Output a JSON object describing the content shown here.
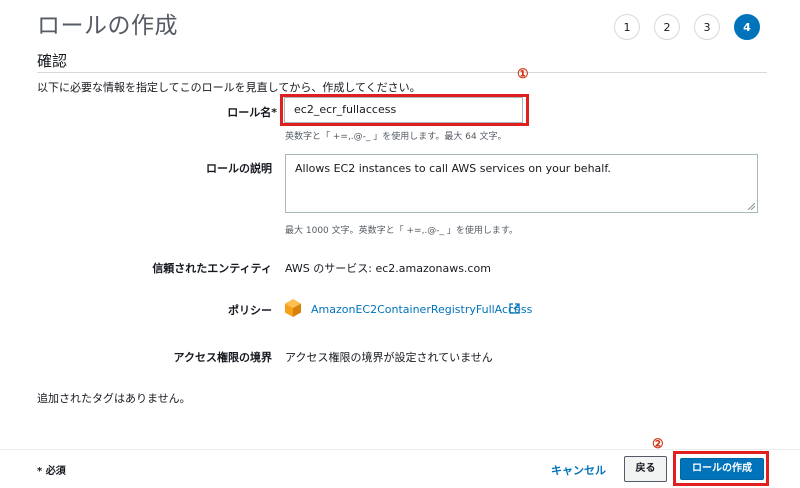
{
  "page": {
    "title": "ロールの作成"
  },
  "steps": [
    "1",
    "2",
    "3",
    "4"
  ],
  "section": {
    "title": "確認",
    "intro": "以下に必要な情報を指定してこのロールを見直してから、作成してください。"
  },
  "markers": {
    "first": "①",
    "second": "②"
  },
  "fields": {
    "role_name": {
      "label": "ロール名*",
      "value": "ec2_ecr_fullaccess",
      "hint": "英数字と「 +=,.@-_ 」を使用します。最大 64 文字。"
    },
    "role_description": {
      "label": "ロールの説明",
      "value": "Allows EC2 instances to call AWS services on your behalf.",
      "hint": "最大 1000 文字。英数字と「 +=,.@-_ 」を使用します。"
    },
    "trusted_entity": {
      "label": "信頼されたエンティティ",
      "value": "AWS のサービス: ec2.amazonaws.com"
    },
    "policy": {
      "label": "ポリシー",
      "value": "AmazonEC2ContainerRegistryFullAccess"
    },
    "permissions_boundary": {
      "label": "アクセス権限の境界",
      "value": "アクセス権限の境界が設定されていません"
    }
  },
  "tags_note": "追加されたタグはありません。",
  "footer": {
    "required_note": "* 必須",
    "cancel_label": "キャンセル",
    "back_label": "戻る",
    "create_label": "ロールの作成"
  },
  "colors": {
    "accent": "#0073bb",
    "highlight": "#e02020",
    "policy_icon": "#f7a01c"
  },
  "icons": {
    "policy": "policy-cube-icon",
    "external": "external-link-icon",
    "resize": "resize-handle-icon"
  }
}
